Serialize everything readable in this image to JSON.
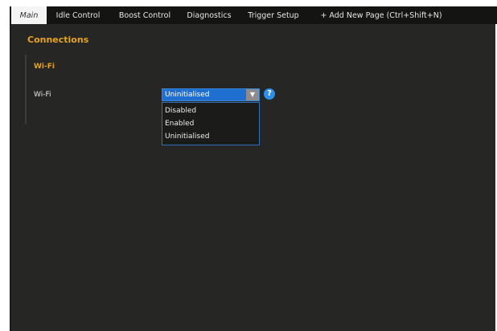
{
  "tabs": [
    {
      "label": "Main",
      "active": true
    },
    {
      "label": "Idle Control",
      "active": false
    },
    {
      "label": "Boost Control",
      "active": false
    },
    {
      "label": "Diagnostics",
      "active": false
    },
    {
      "label": "Trigger Setup",
      "active": false
    },
    {
      "label": "+ Add New Page (Ctrl+Shift+N)",
      "active": false
    }
  ],
  "page": {
    "title": "Connections"
  },
  "wifi_section": {
    "title": "Wi-Fi",
    "field_label": "Wi-Fi",
    "selected_value": "Uninitialised",
    "options": [
      "Disabled",
      "Enabled",
      "Uninitialised"
    ],
    "dropdown_open": true,
    "help_glyph": "?",
    "arrow_glyph": "▼"
  },
  "icons": {
    "dropdown_arrow": "chevron-down-icon",
    "help": "help-icon"
  },
  "colors": {
    "background": "#262624",
    "tab_bar": "#141413",
    "active_tab": "#f4f4f4",
    "accent": "#e8a31e",
    "selection": "#1f6fd0",
    "help_icon": "#2e8fe6"
  }
}
